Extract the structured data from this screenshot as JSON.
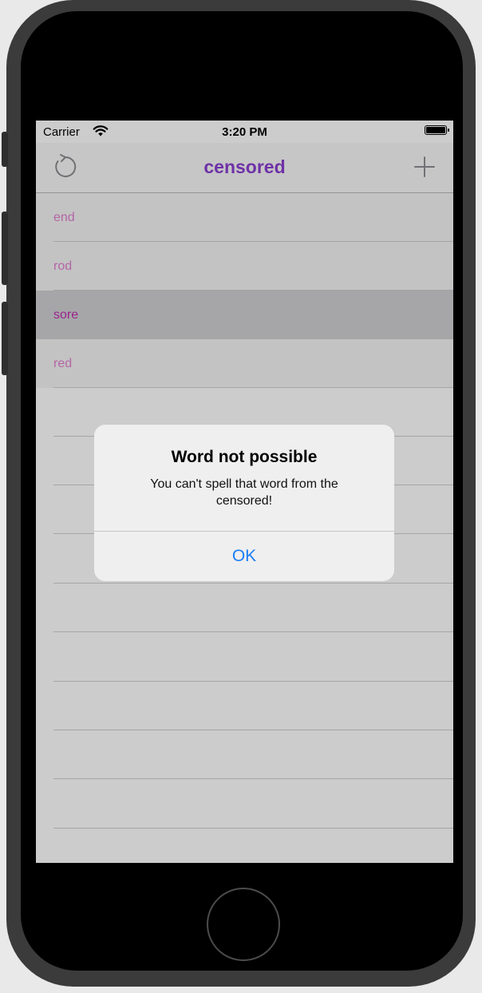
{
  "status_bar": {
    "carrier": "Carrier",
    "time": "3:20 PM"
  },
  "nav": {
    "title": "censored",
    "left_icon": "refresh-icon",
    "right_icon": "add-icon"
  },
  "words": [
    {
      "label": "end",
      "selected": false
    },
    {
      "label": "rod",
      "selected": false
    },
    {
      "label": "sore",
      "selected": true
    },
    {
      "label": "red",
      "selected": false
    }
  ],
  "alert": {
    "title": "Word not possible",
    "message": "You can't spell that word from the censored!",
    "ok_label": "OK"
  },
  "colors": {
    "title": "#8a3fd1",
    "word_text": "#e27fd0",
    "selected_word_text": "#c22cae",
    "alert_button": "#1a7ef5"
  }
}
